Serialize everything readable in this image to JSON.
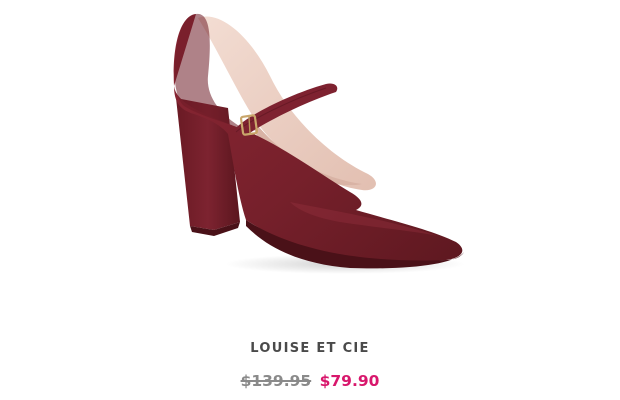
{
  "product": {
    "image_subject": "burgundy suede Mary Jane block-heel pump",
    "brand": "LOUISE ET CIE",
    "original_price": "$139.95",
    "sale_price": "$79.90"
  },
  "colors": {
    "shoe": "#7a1e2a",
    "sale_price": "#d8176c",
    "original_price": "#8a8a8a",
    "brand_text": "#4a4a4a",
    "background": "#ffffff"
  }
}
